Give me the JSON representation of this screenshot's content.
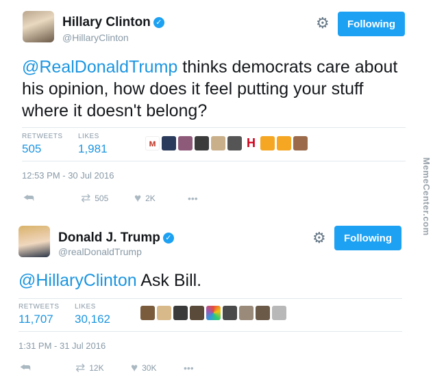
{
  "tweets": [
    {
      "name": "Hillary Clinton",
      "handle": "@HillaryClinton",
      "follow_label": "Following",
      "text_mention": "@RealDonaldTrump",
      "text_body": " thinks democrats care about his opinion, how does it feel putting your stuff where it doesn't belong?",
      "retweets_label": "RETWEETS",
      "retweets": "505",
      "likes_label": "LIKES",
      "likes": "1,981",
      "timestamp": "12:53 PM - 30 Jul 2016",
      "action_retweet_count": "505",
      "action_like_count": "2K",
      "more": "•••"
    },
    {
      "name": "Donald J. Trump",
      "handle": "@realDonaldTrump",
      "follow_label": "Following",
      "text_mention": "@HillaryClinton",
      "text_body": " Ask Bill.",
      "retweets_label": "RETWEETS",
      "retweets": "11,707",
      "likes_label": "LIKES",
      "likes": "30,162",
      "timestamp": "1:31 PM - 31 Jul 2016",
      "action_retweet_count": "12K",
      "action_like_count": "30K",
      "more": "•••"
    }
  ],
  "icons": {
    "verified": "✓",
    "gear": "⚙",
    "reply": "⮪",
    "retweet": "⇄",
    "like": "♥"
  },
  "watermark": "MemeCenter.com",
  "colors": {
    "accent": "#1da1f2",
    "link": "#1b95e0",
    "muted": "#8899a6"
  }
}
